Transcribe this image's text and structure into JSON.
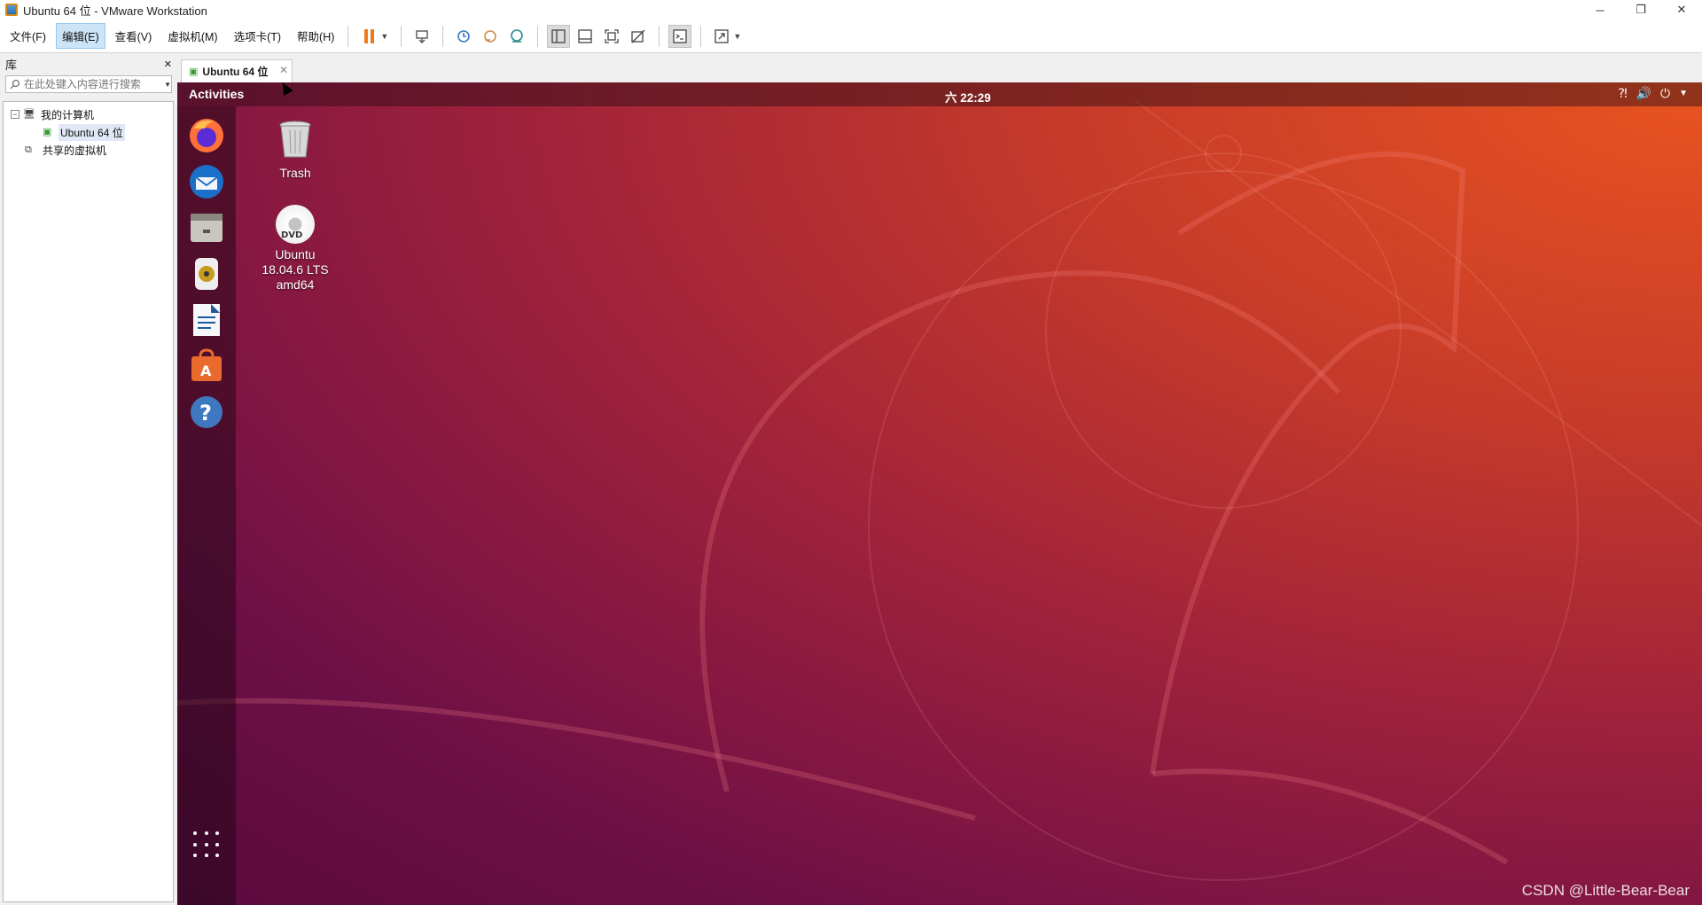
{
  "window": {
    "title": "Ubuntu 64 位 - VMware Workstation",
    "minimize": "─",
    "restore": "❐",
    "close": "✕"
  },
  "menu": [
    "文件(F)",
    "编辑(E)",
    "查看(V)",
    "虚拟机(M)",
    "选项卡(T)",
    "帮助(H)"
  ],
  "menu_active_index": 1,
  "toolbar": {
    "icons": [
      "pause-icon",
      "send-ctrl-alt-del-icon",
      "snapshot-icon",
      "revert-snapshot-icon",
      "snapshot-manager-icon",
      "library-view-icon",
      "thumbnail-bar-icon",
      "full-screen-icon",
      "unity-icon",
      "console-view-icon",
      "stretch-view-icon"
    ]
  },
  "library": {
    "title": "库",
    "close": "✕",
    "search_placeholder": "在此处键入内容进行搜索",
    "tree": {
      "my_computer": "我的计算机",
      "vm": "Ubuntu 64 位",
      "shared": "共享的虚拟机"
    }
  },
  "tab": {
    "label": "Ubuntu 64 位",
    "close": "✕"
  },
  "ubuntu": {
    "activities": "Activities",
    "clock": "六 22:29",
    "tray": [
      "network-icon",
      "volume-icon",
      "power-icon",
      "menu-caret-icon"
    ],
    "dock": [
      "Firefox",
      "Thunderbird",
      "Files",
      "Rhythmbox",
      "LibreOffice Writer",
      "Ubuntu Software",
      "Help"
    ],
    "desktop": {
      "trash": "Trash",
      "dvd_line1": "Ubuntu",
      "dvd_line2": "18.04.6 LTS",
      "dvd_line3": "amd64",
      "dvd_badge": "DVD"
    }
  },
  "watermark": "CSDN @Little-Bear-Bear",
  "colors": {
    "ubuntu_orange": "#e95420",
    "aubergine": "#5a0a3e",
    "pause_orange": "#f07a1a"
  }
}
